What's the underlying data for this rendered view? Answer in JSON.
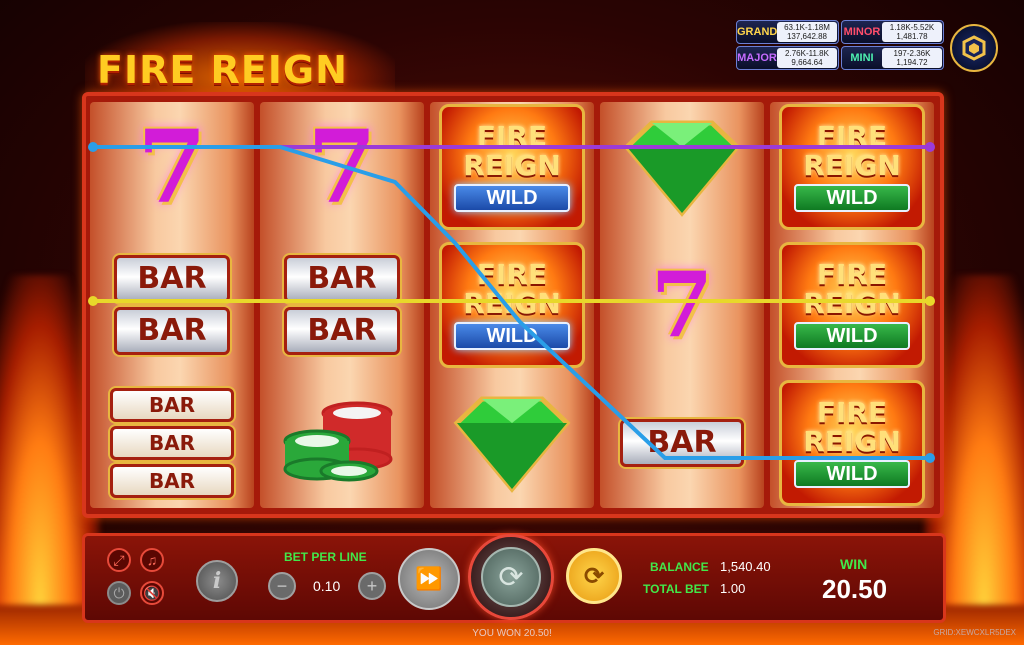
{
  "game": {
    "title": "FIRE REIGN"
  },
  "jackpots": {
    "grand": {
      "name": "GRAND",
      "range": "63.1K-1.18M",
      "value": "137,642.88"
    },
    "minor": {
      "name": "MINOR",
      "range": "1.18K-5.52K",
      "value": "1,481.78"
    },
    "major": {
      "name": "MAJOR",
      "range": "2.76K-11.8K",
      "value": "9,664.64"
    },
    "mini": {
      "name": "MINI",
      "range": "197-2.36K",
      "value": "1,194.72"
    }
  },
  "reels": [
    [
      "seven",
      "bar2",
      "bar3"
    ],
    [
      "seven",
      "bar2",
      "chips"
    ],
    [
      "fire_reign_wild_blue",
      "fire_reign_wild_blue",
      "green_gem"
    ],
    [
      "green_gem",
      "seven",
      "bar1"
    ],
    [
      "fire_reign_wild_green",
      "fire_reign_wild_green",
      "fire_reign_wild_green"
    ]
  ],
  "symbols": {
    "bar": "BAR",
    "seven": "7",
    "fire_line1": "FIRE",
    "fire_line2": "REIGN",
    "wild": "WILD"
  },
  "paylines_colors": {
    "purple": "#9b3bd8",
    "yellow": "#e8d82a",
    "blue": "#2a9ee8"
  },
  "controls": {
    "bet_per_line_label": "BET PER LINE",
    "bet_per_line_value": "0.10",
    "minus": "−",
    "plus": "+",
    "balance_label": "BALANCE",
    "balance_value": "1,540.40",
    "total_bet_label": "TOTAL BET",
    "total_bet_value": "1.00",
    "win_label": "WIN",
    "win_value": "20.50",
    "info": "i",
    "icons": [
      "fullscreen-icon",
      "music-icon",
      "power-icon",
      "sound-muted-icon",
      "turbo-icon",
      "spin-icon",
      "autoplay-icon"
    ]
  },
  "footer": {
    "message": "YOU WON 20.50!",
    "grid_id": "GRID:XEWCXLR5DEX"
  }
}
